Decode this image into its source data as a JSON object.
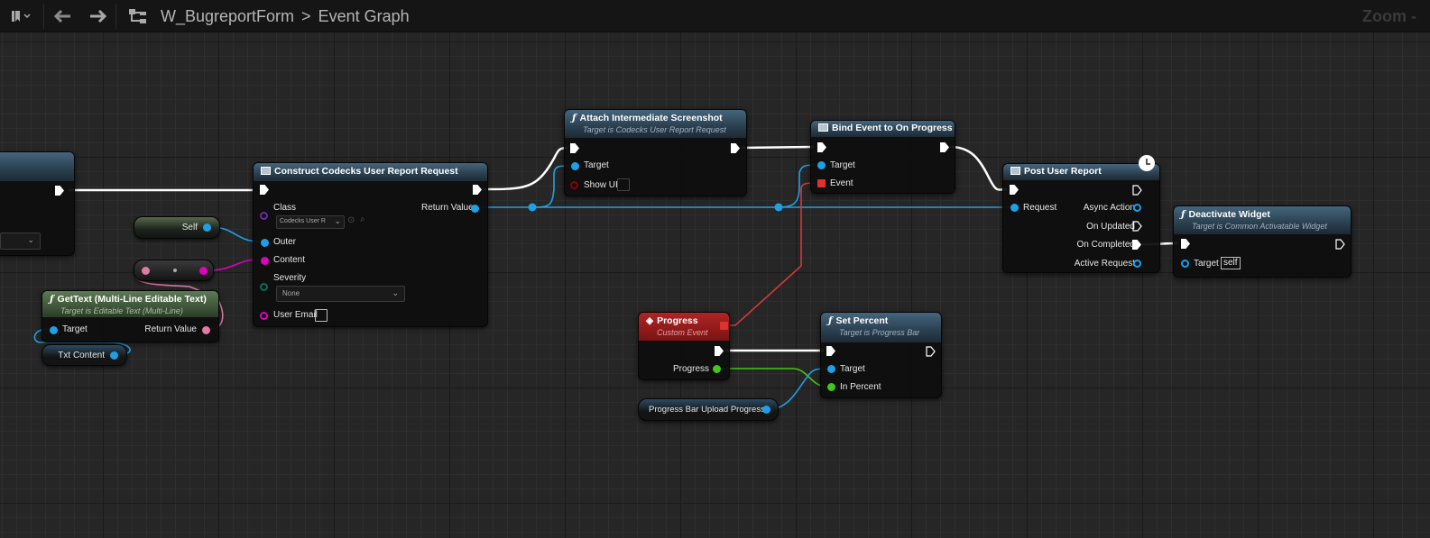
{
  "toolbar": {
    "bookmark_icon": "bookmark-icon",
    "back_icon": "arrow-left-icon",
    "forward_icon": "arrow-right-icon",
    "graph_icon": "graph-icon",
    "breadcrumb": [
      "W_BugreportForm",
      "Event Graph"
    ],
    "separator": ">",
    "zoom_label": "Zoom -"
  },
  "colors": {
    "exec": "#ffffff",
    "object": "#1fa0e6",
    "text": "#e83ca8",
    "text_pink": "#e07aa6",
    "float": "#45c51c",
    "delegate": "#e03030",
    "class": "#6a2aa8",
    "enum": "#0e6a63",
    "string": "#e000c0",
    "bool": "#8a0000"
  },
  "nodes": {
    "construct": {
      "title": "Construct Codecks User Report Request",
      "class_label": "Class",
      "class_value": "Codecks User R",
      "return_label": "Return Value",
      "outer_label": "Outer",
      "content_label": "Content",
      "severity_label": "Severity",
      "severity_value": "None",
      "email_label": "User Email"
    },
    "self_var": {
      "label": "Self"
    },
    "gettext": {
      "title": "GetText (Multi-Line Editable Text)",
      "subtitle": "Target is Editable Text (Multi-Line)",
      "target_label": "Target",
      "return_label": "Return Value"
    },
    "txt_content": {
      "label": "Txt Content"
    },
    "attach": {
      "title": "Attach Intermediate Screenshot",
      "subtitle": "Target is Codecks User Report Request",
      "target_label": "Target",
      "showui_label": "Show UI"
    },
    "bind": {
      "title": "Bind Event to On Progress",
      "target_label": "Target",
      "event_label": "Event"
    },
    "post": {
      "title": "Post User Report",
      "request_label": "Request",
      "async_label": "Async Action",
      "updated_label": "On Updated",
      "completed_label": "On Completed",
      "active_label": "Active Request"
    },
    "deactivate": {
      "title": "Deactivate Widget",
      "subtitle": "Target is Common Activatable Widget",
      "target_label": "Target",
      "target_value": "self"
    },
    "progress_event": {
      "title": "Progress",
      "subtitle": "Custom Event",
      "progress_label": "Progress"
    },
    "set_percent": {
      "title": "Set Percent",
      "subtitle": "Target is Progress Bar",
      "target_label": "Target",
      "percent_label": "In Percent"
    },
    "progress_bar_var": {
      "label": "Progress Bar Upload Progress"
    }
  }
}
